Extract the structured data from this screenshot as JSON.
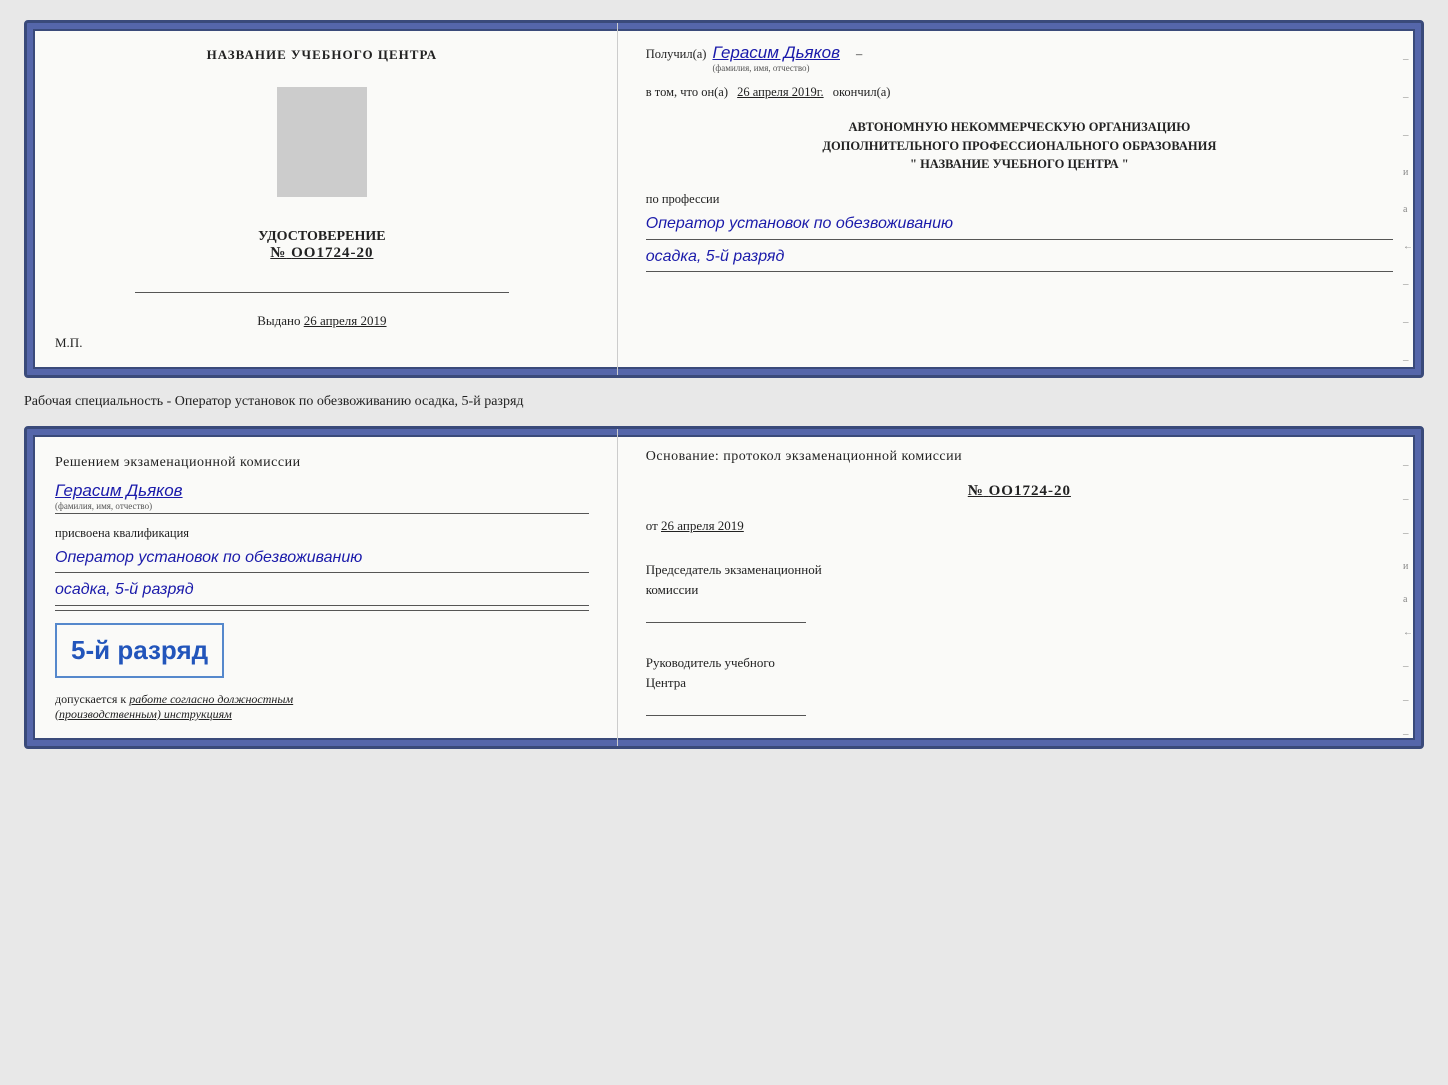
{
  "card1": {
    "left": {
      "title": "НАЗВАНИЕ УЧЕБНОГО ЦЕНТРА",
      "cert_label": "УДОСТОВЕРЕНИЕ",
      "cert_number_prefix": "№",
      "cert_number": "OO1724-20",
      "issued_label": "Выдано",
      "issued_date": "26 апреля 2019",
      "mp_label": "М.П."
    },
    "right": {
      "received_prefix": "Получил(а)",
      "recipient_name": "Герасим Дьяков",
      "name_sublabel": "(фамилия, имя, отчество)",
      "dash": "–",
      "confirmed_text": "в том, что он(а)",
      "confirmed_date": "26 апреля 2019г.",
      "confirmed_suffix": "окончил(а)",
      "org_line1": "АВТОНОМНУЮ НЕКОММЕРЧЕСКУЮ ОРГАНИЗАЦИЮ",
      "org_line2": "ДОПОЛНИТЕЛЬНОГО ПРОФЕССИОНАЛЬНОГО ОБРАЗОВАНИЯ",
      "org_line3": "\"  НАЗВАНИЕ УЧЕБНОГО ЦЕНТРА  \"",
      "profession_label": "по профессии",
      "profession_value": "Оператор установок по обезвоживанию",
      "profession_detail": "осадка, 5-й разряд"
    }
  },
  "specialty_text": "Рабочая специальность - Оператор установок по обезвоживанию осадка, 5-й разряд",
  "card2": {
    "left": {
      "decision_text": "Решением экзаменационной комиссии",
      "person_name": "Герасим Дьяков",
      "name_sublabel": "(фамилия, имя, отчество)",
      "assigned_text": "присвоена квалификация",
      "qualification_line1": "Оператор установок по обезвоживанию",
      "qualification_line2": "осадка, 5-й разряд",
      "stamp_rank": "5-й разряд",
      "admitted_prefix": "допускается к",
      "admitted_work": "работе согласно должностным",
      "admitted_suffix": "(производственным) инструкциям"
    },
    "right": {
      "basis_text": "Основание: протокол экзаменационной комиссии",
      "protocol_prefix": "№",
      "protocol_number": "OO1724-20",
      "date_prefix": "от",
      "date_value": "26 апреля 2019",
      "chairman_title_line1": "Председатель экзаменационной",
      "chairman_title_line2": "комиссии",
      "director_title_line1": "Руководитель учебного",
      "director_title_line2": "Центра"
    }
  }
}
